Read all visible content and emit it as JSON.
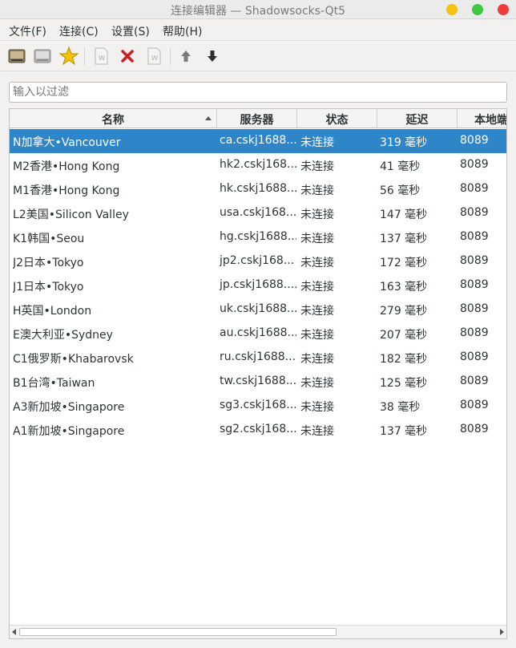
{
  "window": {
    "title": "连接编辑器 — Shadowsocks-Qt5"
  },
  "menu": [
    {
      "label": "文件(F)"
    },
    {
      "label": "连接(C)"
    },
    {
      "label": "设置(S)"
    },
    {
      "label": "帮助(H)"
    }
  ],
  "toolbar": {
    "icons": [
      "connect-icon",
      "disconnect-icon",
      "favorite-star-icon",
      "edit-document-icon",
      "delete-x-icon",
      "share-document-icon",
      "move-up-arrow-icon",
      "move-down-arrow-icon"
    ]
  },
  "filter": {
    "placeholder": "输入以过滤"
  },
  "table": {
    "headers": [
      "名称",
      "服务器",
      "状态",
      "延迟",
      "本地端口"
    ],
    "sort_column": "名称",
    "rows": [
      {
        "name": "N加拿大•Vancouver",
        "server": "ca.cskj1688....",
        "status": "未连接",
        "latency": "319 毫秒",
        "port": "8089",
        "selected": true
      },
      {
        "name": "M2香港•Hong Kong",
        "server": "hk2.cskj168...",
        "status": "未连接",
        "latency": "41 毫秒",
        "port": "8089"
      },
      {
        "name": "M1香港•Hong Kong",
        "server": "hk.cskj1688....",
        "status": "未连接",
        "latency": "56 毫秒",
        "port": "8089"
      },
      {
        "name": "L2美国•Silicon Valley",
        "server": "usa.cskj168...",
        "status": "未连接",
        "latency": "147 毫秒",
        "port": "8089"
      },
      {
        "name": "K1韩国•Seou",
        "server": "hg.cskj1688....",
        "status": "未连接",
        "latency": "137 毫秒",
        "port": "8089"
      },
      {
        "name": "J2日本•Tokyo",
        "server": "jp2.cskj168...",
        "status": "未连接",
        "latency": "172 毫秒",
        "port": "8089"
      },
      {
        "name": "J1日本•Tokyo",
        "server": "jp.cskj1688....",
        "status": "未连接",
        "latency": "163 毫秒",
        "port": "8089"
      },
      {
        "name": "H英国•London",
        "server": "uk.cskj1688....",
        "status": "未连接",
        "latency": "279 毫秒",
        "port": "8089"
      },
      {
        "name": "E澳大利亚•Sydney",
        "server": "au.cskj1688....",
        "status": "未连接",
        "latency": "207 毫秒",
        "port": "8089"
      },
      {
        "name": "C1俄罗斯•Khabarovsk",
        "server": "ru.cskj1688....",
        "status": "未连接",
        "latency": "182 毫秒",
        "port": "8089"
      },
      {
        "name": "B1台湾•Taiwan",
        "server": "tw.cskj1688....",
        "status": "未连接",
        "latency": "125 毫秒",
        "port": "8089"
      },
      {
        "name": "A3新加坡•Singapore",
        "server": "sg3.cskj168...",
        "status": "未连接",
        "latency": "38 毫秒",
        "port": "8089"
      },
      {
        "name": "A1新加坡•Singapore",
        "server": "sg2.cskj168...",
        "status": "未连接",
        "latency": "137 毫秒",
        "port": "8089"
      }
    ]
  },
  "colors": {
    "selection": "#2e86c9",
    "delete": "#cc1f1f",
    "star": "#f2c300"
  }
}
